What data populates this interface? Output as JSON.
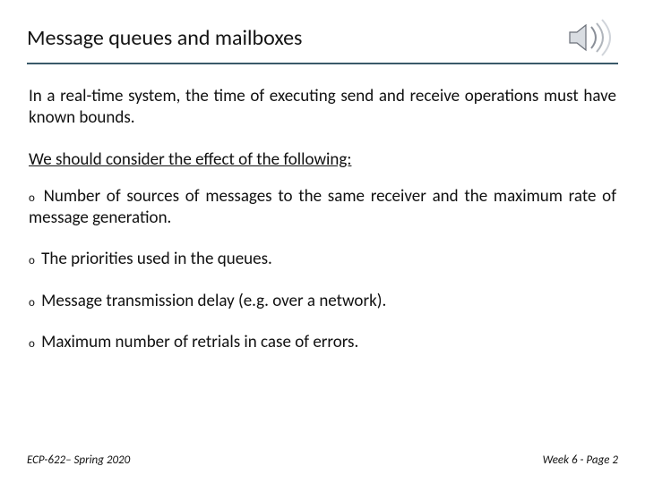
{
  "title": "Message queues and mailboxes",
  "intro": "In a real-time system, the time of executing send and receive operations must have known bounds.",
  "lead": "We should consider the effect of the following:",
  "bullets": [
    "Number of sources of messages to the same receiver and the maximum rate of message generation.",
    "The priorities used in the queues.",
    "Message transmission delay (e.g. over a network).",
    "Maximum number of retrials in case of errors."
  ],
  "footer": {
    "left": "ECP-622– Spring 2020",
    "right": "Week 6 - Page 2"
  },
  "icons": {
    "speaker": "speaker-icon"
  }
}
